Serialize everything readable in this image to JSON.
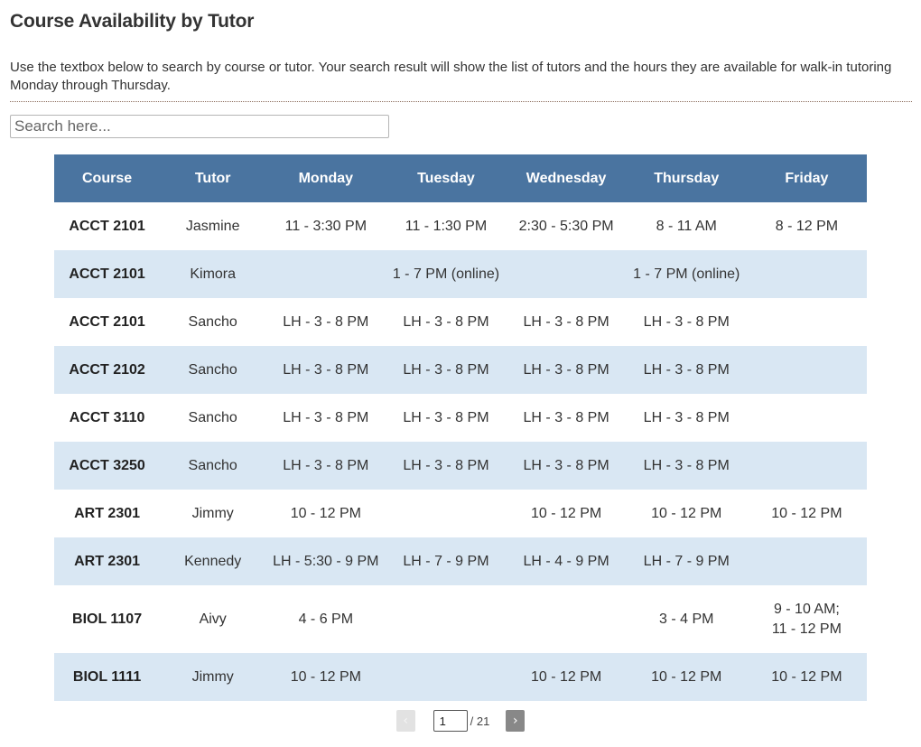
{
  "page": {
    "title": "Course Availability by Tutor",
    "intro": "Use the textbox below to search by course or tutor. Your search result will show the list of tutors and the hours they are available for walk-in tutoring Monday through Thursday."
  },
  "search": {
    "placeholder": "Search here...",
    "value": ""
  },
  "table": {
    "headers": [
      "Course",
      "Tutor",
      "Monday",
      "Tuesday",
      "Wednesday",
      "Thursday",
      "Friday"
    ],
    "rows": [
      [
        "ACCT 2101",
        "Jasmine",
        "11 - 3:30 PM",
        "11 - 1:30 PM",
        "2:30 - 5:30 PM",
        "8 - 11 AM",
        "8 - 12 PM"
      ],
      [
        "ACCT 2101",
        "Kimora",
        "",
        "1 - 7 PM (online)",
        "",
        "1 - 7 PM (online)",
        ""
      ],
      [
        "ACCT 2101",
        "Sancho",
        "LH - 3 - 8 PM",
        "LH - 3 - 8 PM",
        "LH - 3 - 8 PM",
        "LH - 3 - 8 PM",
        ""
      ],
      [
        "ACCT 2102",
        "Sancho",
        "LH - 3 - 8 PM",
        "LH - 3 - 8 PM",
        "LH - 3 - 8 PM",
        "LH - 3 - 8 PM",
        ""
      ],
      [
        "ACCT 3110",
        "Sancho",
        "LH - 3 - 8 PM",
        "LH - 3 - 8 PM",
        "LH - 3 - 8 PM",
        "LH - 3 - 8 PM",
        ""
      ],
      [
        "ACCT 3250",
        "Sancho",
        "LH - 3 - 8 PM",
        "LH - 3 - 8 PM",
        "LH - 3 - 8 PM",
        "LH - 3 - 8 PM",
        ""
      ],
      [
        "ART 2301",
        "Jimmy",
        "10 - 12 PM",
        "",
        "10 - 12 PM",
        "10 - 12 PM",
        "10 - 12 PM"
      ],
      [
        "ART 2301",
        "Kennedy",
        "LH - 5:30 - 9 PM",
        "LH - 7 - 9 PM",
        "LH - 4 - 9 PM",
        "LH - 7 - 9 PM",
        ""
      ],
      [
        "BIOL 1107",
        "Aivy",
        "4 - 6 PM",
        "",
        "",
        "3 - 4 PM",
        "9 - 10 AM;\n11 - 12 PM"
      ],
      [
        "BIOL 1111",
        "Jimmy",
        "10 - 12 PM",
        "",
        "10 - 12 PM",
        "10 - 12 PM",
        "10 - 12 PM"
      ]
    ]
  },
  "pagination": {
    "prev_label": "‹",
    "next_label": "›",
    "current_page": "1",
    "total_label": "/ 21"
  },
  "colors": {
    "header_bg": "#4a74a0",
    "stripe_bg": "#d9e7f3"
  }
}
